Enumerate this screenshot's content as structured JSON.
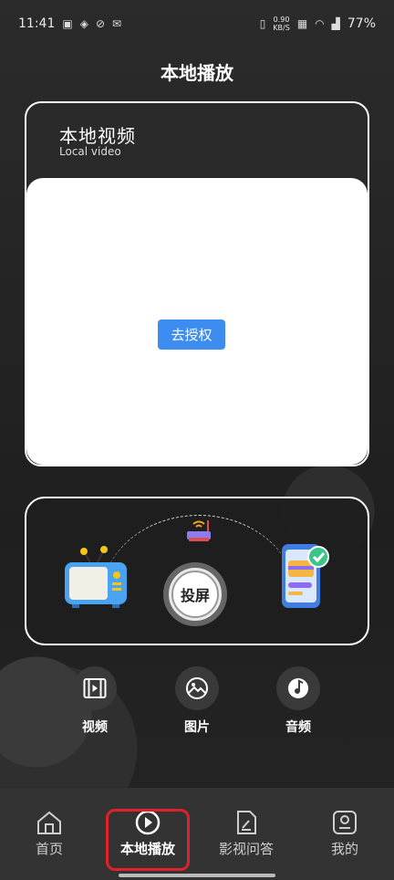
{
  "status_bar": {
    "time": "11:41",
    "network_speed_value": "0.90",
    "network_speed_unit": "KB/S",
    "battery": "77%"
  },
  "page": {
    "title": "本地播放"
  },
  "local_video": {
    "title": "本地视频",
    "subtitle": "Local video",
    "authorize_button": "去授权"
  },
  "cast": {
    "button_label": "投屏"
  },
  "media": [
    {
      "label": "视频",
      "icon": "video-film-icon"
    },
    {
      "label": "图片",
      "icon": "image-icon"
    },
    {
      "label": "音频",
      "icon": "music-disc-icon"
    }
  ],
  "nav": {
    "items": [
      {
        "label": "首页",
        "icon": "home-icon"
      },
      {
        "label": "本地播放",
        "icon": "play-circle-icon",
        "active": true
      },
      {
        "label": "影视问答",
        "icon": "edit-document-icon"
      },
      {
        "label": "我的",
        "icon": "profile-icon"
      }
    ]
  },
  "colors": {
    "accent": "#3d8cf0",
    "highlight": "#e0202a",
    "background": "#262626"
  }
}
